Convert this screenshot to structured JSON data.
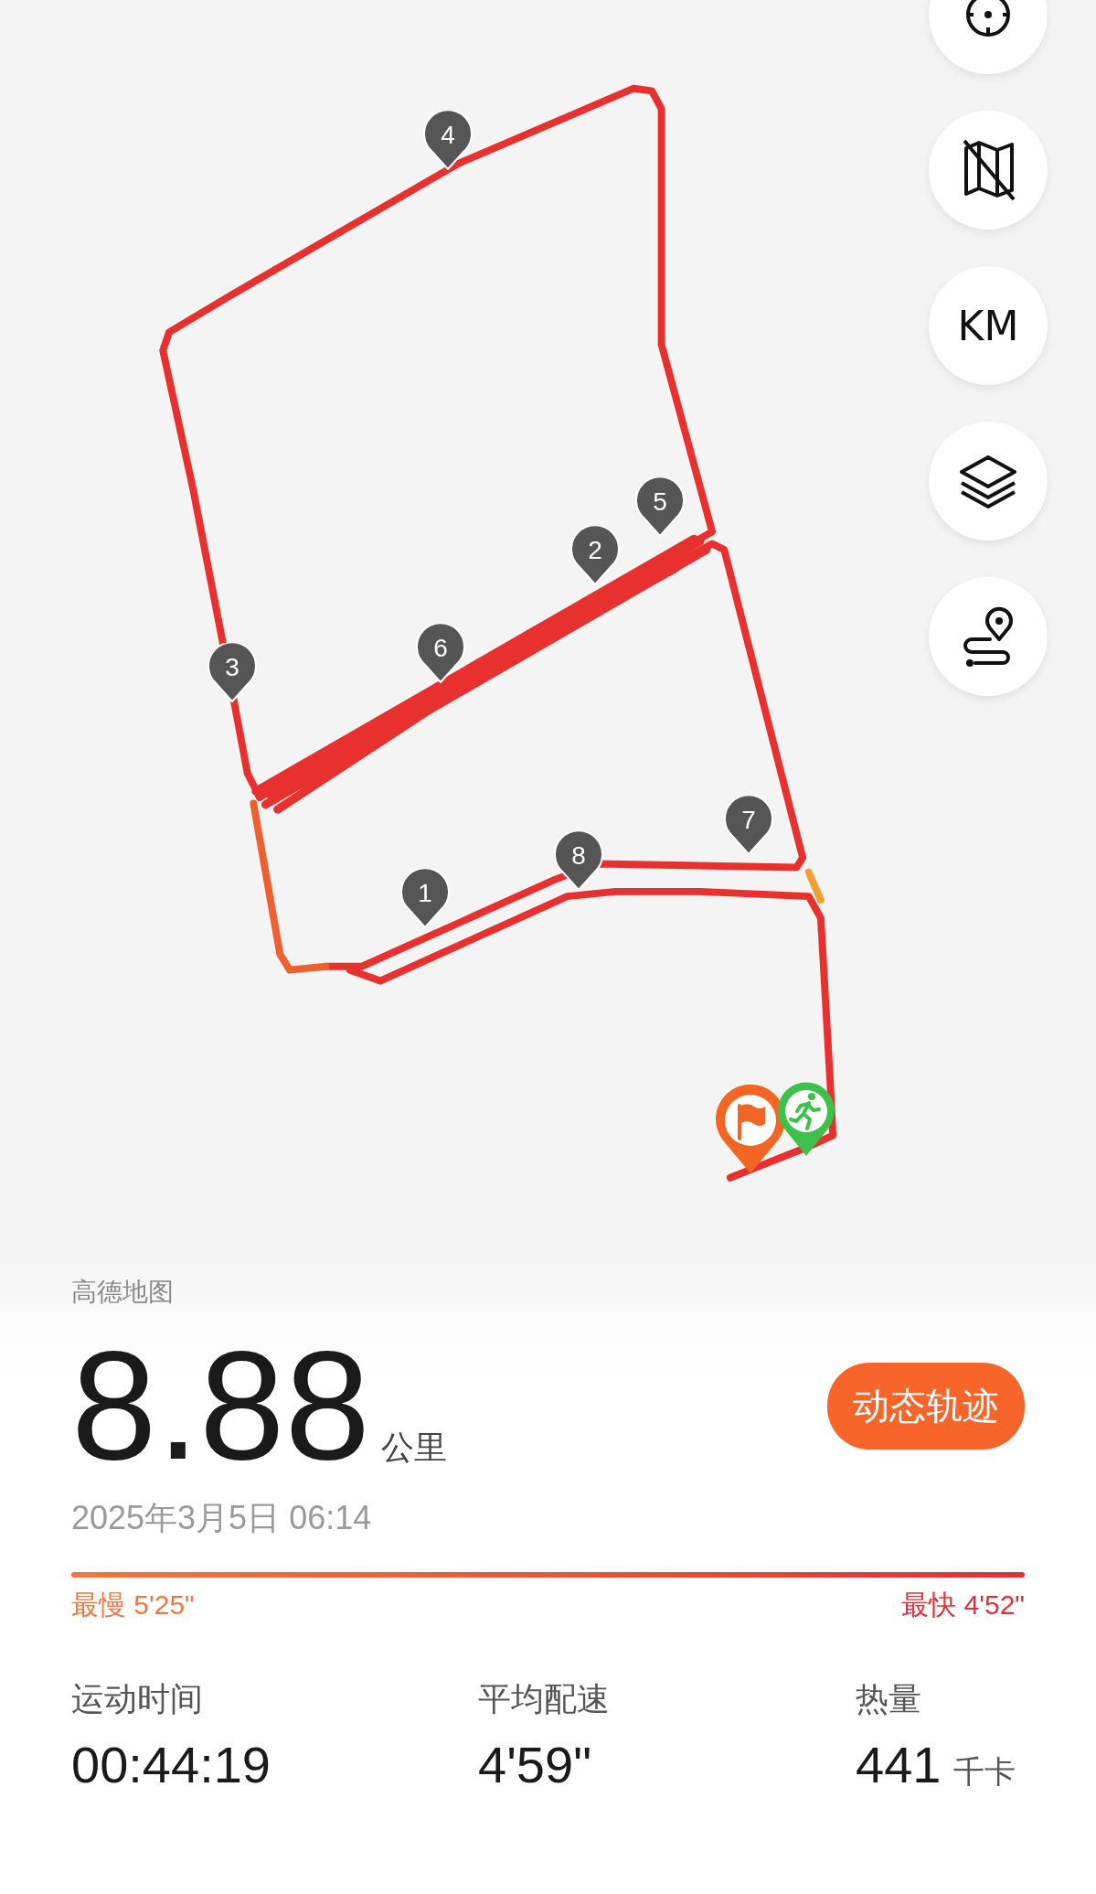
{
  "map": {
    "controls": [
      {
        "kind": "locate"
      },
      {
        "kind": "map-off"
      },
      {
        "kind": "units",
        "label": "KM"
      },
      {
        "kind": "layers"
      },
      {
        "kind": "route"
      }
    ],
    "km_markers": [
      "1",
      "2",
      "3",
      "4",
      "5",
      "6",
      "7",
      "8"
    ],
    "attribution": "高德地图"
  },
  "summary": {
    "distance": "8.88",
    "unit": "公里",
    "replay_button": "动态轨迹",
    "date": "2025年3月5日 06:14",
    "slowest": "最慢 5'25\"",
    "fastest": "最快 4'52\""
  },
  "stats": [
    {
      "label": "运动时间",
      "value": "00:44:19"
    },
    {
      "label": "平均配速",
      "value": "4'59\""
    },
    {
      "label": "热量",
      "value": "441",
      "unit": "千卡"
    }
  ]
}
